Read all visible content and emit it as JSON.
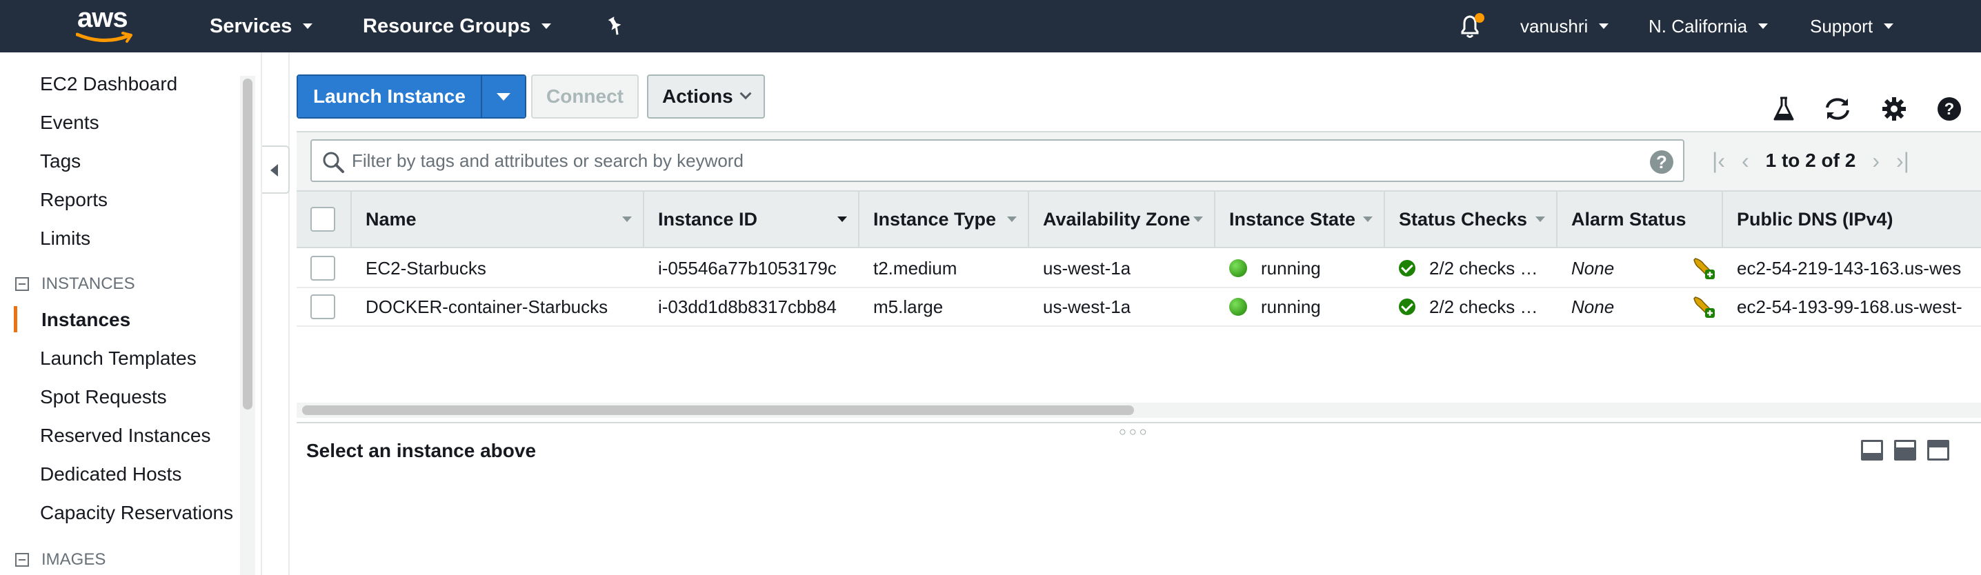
{
  "topnav": {
    "logo_text": "aws",
    "services": "Services",
    "resource_groups": "Resource Groups",
    "user": "vanushri",
    "region": "N. California",
    "support": "Support",
    "notification_color": "#ff9900"
  },
  "sidebar": {
    "items_top": [
      "EC2 Dashboard",
      "Events",
      "Tags",
      "Reports",
      "Limits"
    ],
    "section_instances": "INSTANCES",
    "items_instances": [
      "Instances",
      "Launch Templates",
      "Spot Requests",
      "Reserved Instances",
      "Dedicated Hosts",
      "Capacity Reservations"
    ],
    "active_item": "Instances",
    "section_images": "IMAGES",
    "accent": "#ec7211"
  },
  "toolbar": {
    "launch_label": "Launch Instance",
    "connect_label": "Connect",
    "actions_label": "Actions",
    "icons": [
      "flask-icon",
      "refresh-icon",
      "gear-icon",
      "help-icon"
    ]
  },
  "search": {
    "placeholder": "Filter by tags and attributes or search by keyword",
    "help": "?"
  },
  "pager": {
    "text": "1 to 2 of 2"
  },
  "table": {
    "columns": [
      "Name",
      "Instance ID",
      "Instance Type",
      "Availability Zone",
      "Instance State",
      "Status Checks",
      "Alarm Status",
      "Public DNS (IPv4)"
    ],
    "rows": [
      {
        "name": "EC2-Starbucks",
        "instance_id": "i-05546a77b1053179c",
        "type": "t2.medium",
        "zone": "us-west-1a",
        "state": "running",
        "checks": "2/2 checks …",
        "alarm": "None",
        "dns": "ec2-54-219-143-163.us-wes"
      },
      {
        "name": "DOCKER-container-Starbucks",
        "instance_id": "i-03dd1d8b8317cbb84",
        "type": "m5.large",
        "zone": "us-west-1a",
        "state": "running",
        "checks": "2/2 checks …",
        "alarm": "None",
        "dns": "ec2-54-193-99-168.us-west-"
      }
    ]
  },
  "detail": {
    "title": "Select an instance above"
  }
}
